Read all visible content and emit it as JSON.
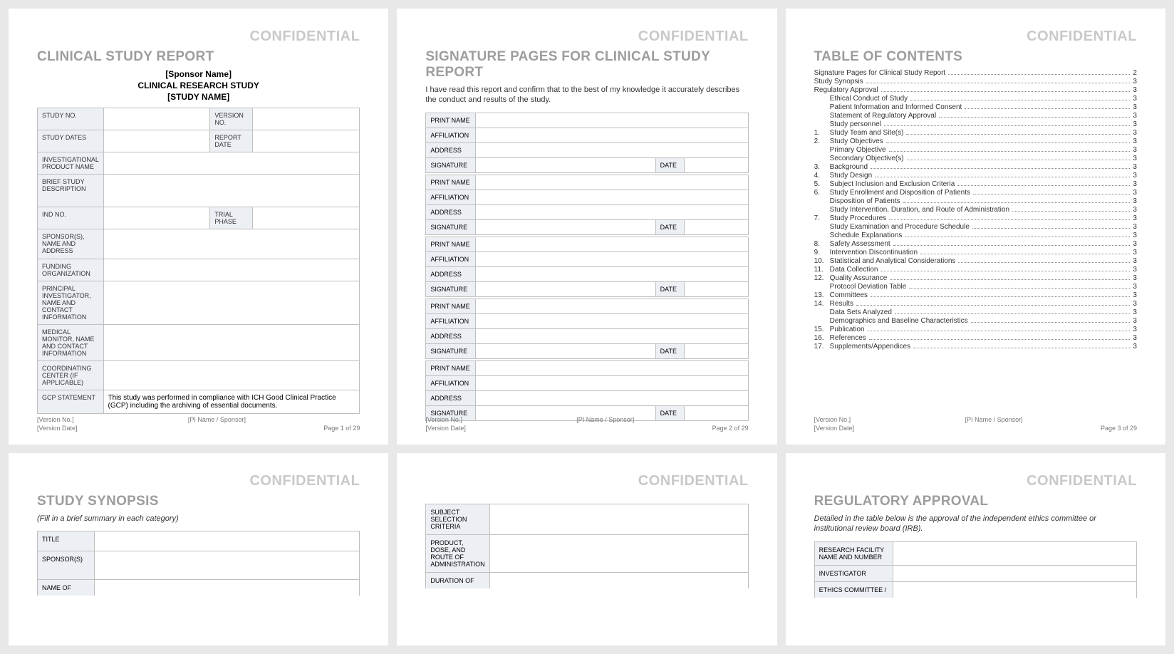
{
  "confidential": "CONFIDENTIAL",
  "footer": {
    "version_no": "[Version No.]",
    "version_date": "[Version Date]",
    "pi": "[PI Name / Sponsor]",
    "page1": "Page 1 of 29",
    "page2": "Page 2 of 29",
    "page3": "Page 3 of 29"
  },
  "page1": {
    "title": "CLINICAL STUDY REPORT",
    "sponsor": "[Sponsor Name]",
    "research": "CLINICAL RESEARCH STUDY",
    "study_name": "[STUDY NAME]",
    "labels": {
      "study_no": "STUDY NO.",
      "version_no": "VERSION NO.",
      "study_dates": "STUDY DATES",
      "report_date": "REPORT DATE",
      "product": "INVESTIGATIONAL PRODUCT NAME",
      "brief": "BRIEF STUDY DESCRIPTION",
      "ind": "IND NO.",
      "trial_phase": "TRIAL PHASE",
      "sponsors": "SPONSOR(S), NAME AND ADDRESS",
      "funding": "FUNDING ORGANIZATION",
      "pi": "PRINCIPAL INVESTIGATOR, NAME AND CONTACT INFORMATION",
      "monitor": "MEDICAL MONITOR, NAME AND CONTACT INFORMATION",
      "center": "COORDINATING CENTER (if applicable)",
      "gcp": "GCP STATEMENT"
    },
    "gcp_text": "This study was performed in compliance with ICH Good Clinical Practice (GCP) including the archiving of essential documents."
  },
  "page2": {
    "title": "SIGNATURE PAGES FOR CLINICAL STUDY REPORT",
    "intro": "I have read this report and confirm that to the best of my knowledge it accurately describes the conduct and results of the study.",
    "labels": {
      "print": "PRINT NAME",
      "affiliation": "AFFILIATION",
      "address": "ADDRESS",
      "signature": "SIGNATURE",
      "date": "DATE"
    }
  },
  "page3": {
    "title": "TABLE OF CONTENTS",
    "toc": [
      {
        "num": "",
        "text": "Signature Pages for Clinical Study Report",
        "page": "2",
        "sub": false
      },
      {
        "num": "",
        "text": "Study Synopsis",
        "page": "3",
        "sub": false
      },
      {
        "num": "",
        "text": "Regulatory Approval",
        "page": "3",
        "sub": false
      },
      {
        "num": "",
        "text": "Ethical Conduct of Study",
        "page": "3",
        "sub": true
      },
      {
        "num": "",
        "text": "Patient Information and Informed Consent",
        "page": "3",
        "sub": true
      },
      {
        "num": "",
        "text": "Statement of Regulatory Approval",
        "page": "3",
        "sub": true
      },
      {
        "num": "",
        "text": "Study personnel",
        "page": "3",
        "sub": true
      },
      {
        "num": "1.",
        "text": "Study Team and Site(s)",
        "page": "3",
        "sub": false
      },
      {
        "num": "2.",
        "text": "Study Objectives",
        "page": "3",
        "sub": false
      },
      {
        "num": "",
        "text": "Primary Objective",
        "page": "3",
        "sub": true
      },
      {
        "num": "",
        "text": "Secondary Objective(s)",
        "page": "3",
        "sub": true
      },
      {
        "num": "3.",
        "text": "Background",
        "page": "3",
        "sub": false
      },
      {
        "num": "4.",
        "text": "Study Design",
        "page": "3",
        "sub": false
      },
      {
        "num": "5.",
        "text": "Subject Inclusion and Exclusion Criteria",
        "page": "3",
        "sub": false
      },
      {
        "num": "6.",
        "text": "Study Enrollment and Disposition of Patients",
        "page": "3",
        "sub": false
      },
      {
        "num": "",
        "text": "Disposition of Patients",
        "page": "3",
        "sub": true
      },
      {
        "num": "",
        "text": "Study Intervention, Duration, and Route of Administration",
        "page": "3",
        "sub": true
      },
      {
        "num": "7.",
        "text": "Study Procedures",
        "page": "3",
        "sub": false
      },
      {
        "num": "",
        "text": "Study Examination and Procedure Schedule",
        "page": "3",
        "sub": true
      },
      {
        "num": "",
        "text": "Schedule Explanations",
        "page": "3",
        "sub": true
      },
      {
        "num": "8.",
        "text": "Safety Assessment",
        "page": "3",
        "sub": false
      },
      {
        "num": "9.",
        "text": "Intervention Discontinuation",
        "page": "3",
        "sub": false
      },
      {
        "num": "10.",
        "text": "Statistical and Analytical Considerations",
        "page": "3",
        "sub": false
      },
      {
        "num": "11.",
        "text": "Data Collection",
        "page": "3",
        "sub": false
      },
      {
        "num": "12.",
        "text": "Quality Assurance",
        "page": "3",
        "sub": false
      },
      {
        "num": "",
        "text": "Protocol Deviation Table",
        "page": "3",
        "sub": true
      },
      {
        "num": "13.",
        "text": "Committees",
        "page": "3",
        "sub": false
      },
      {
        "num": "14.",
        "text": "Results",
        "page": "3",
        "sub": false
      },
      {
        "num": "",
        "text": "Data Sets Analyzed",
        "page": "3",
        "sub": true
      },
      {
        "num": "",
        "text": "Demographics and Baseline Characteristics",
        "page": "3",
        "sub": true
      },
      {
        "num": "15.",
        "text": "Publication",
        "page": "3",
        "sub": false
      },
      {
        "num": "16.",
        "text": "References",
        "page": "3",
        "sub": false
      },
      {
        "num": "17.",
        "text": "Supplements/Appendices",
        "page": "3",
        "sub": false
      }
    ]
  },
  "page4": {
    "title": "STUDY SYNOPSIS",
    "intro": "(Fill in a brief summary in each category)",
    "labels": {
      "title": "TITLE",
      "sponsors": "SPONSOR(S)",
      "name_of": "NAME OF"
    }
  },
  "page5": {
    "labels": {
      "criteria": "SUBJECT SELECTION CRITERIA",
      "product": "PRODUCT, DOSE, AND ROUTE OF ADMINISTRATION",
      "duration": "DURATION OF"
    }
  },
  "page6": {
    "title": "REGULATORY APPROVAL",
    "intro": "Detailed in the table below is the approval of the independent ethics committee or institutional review board (IRB).",
    "labels": {
      "facility": "RESEARCH FACILITY NAME AND NUMBER",
      "investigator": "INVESTIGATOR",
      "ethics": "ETHICS COMMITTEE /"
    }
  }
}
